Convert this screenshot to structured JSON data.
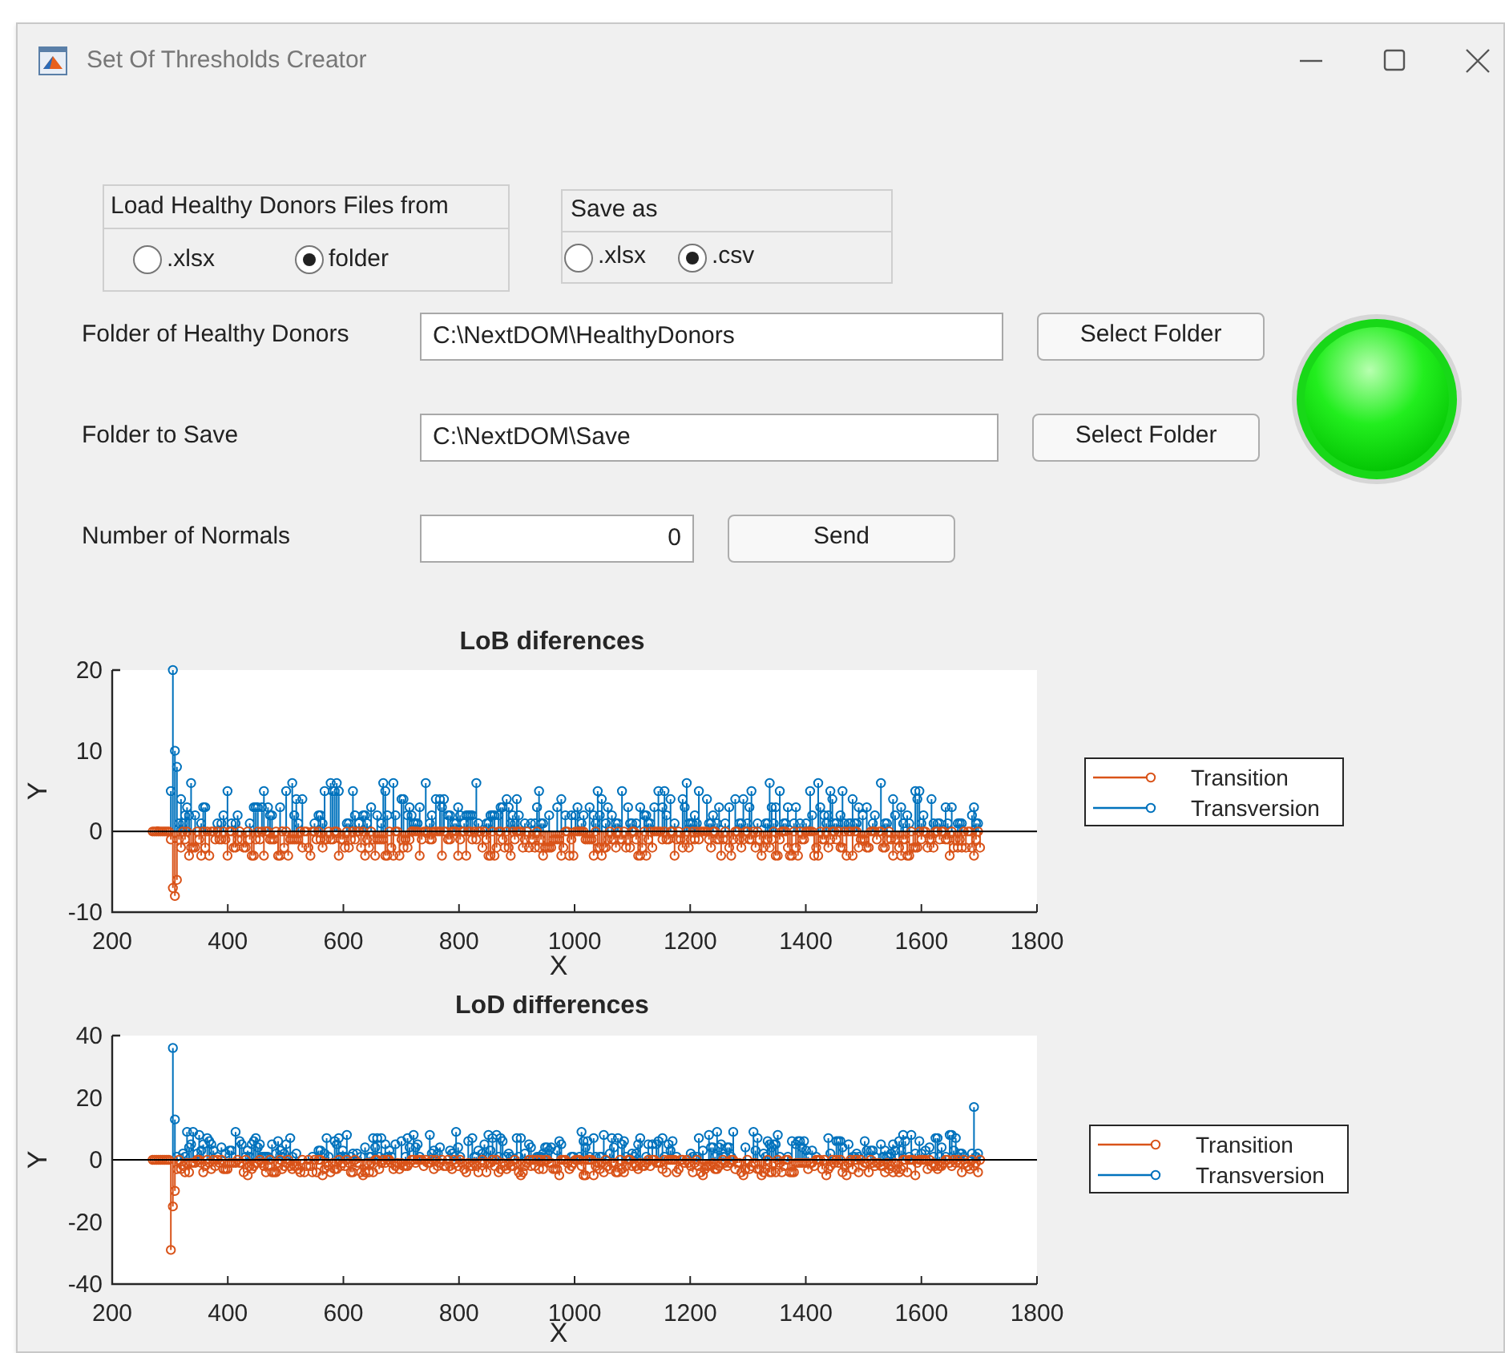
{
  "window": {
    "title": "Set Of Thresholds Creator"
  },
  "load_group": {
    "title": "Load Healthy Donors Files from",
    "options": [
      {
        "label": ".xlsx",
        "selected": false
      },
      {
        "label": "folder",
        "selected": true
      }
    ]
  },
  "save_group": {
    "title": "Save as",
    "options": [
      {
        "label": ".xlsx",
        "selected": false
      },
      {
        "label": ".csv",
        "selected": true
      }
    ]
  },
  "rows": [
    {
      "kind": "path",
      "label": "Folder of Healthy Donors",
      "value": "C:\\NextDOM\\HealthyDonors",
      "button": "Select Folder"
    },
    {
      "kind": "path",
      "label": "Folder to Save",
      "value": "C:\\NextDOM\\Save",
      "button": "Select Folder"
    },
    {
      "kind": "number",
      "label": "Number of Normals",
      "value": "0",
      "button": "Send"
    }
  ],
  "lamp": {
    "on": true
  },
  "plots": [
    {
      "title": "LoB diferences",
      "xlabel": "X",
      "ylabel": "Y",
      "xticks": [
        "200",
        "400",
        "600",
        "800",
        "1000",
        "1200",
        "1400",
        "1600",
        "1800"
      ],
      "yticks": [
        "20",
        "10",
        "0",
        "-10"
      ],
      "legend": [
        {
          "name": "Transition",
          "color": "#d95319"
        },
        {
          "name": "Transversion",
          "color": "#0072bd"
        }
      ]
    },
    {
      "title": "LoD differences",
      "xlabel": "X",
      "ylabel": "Y",
      "xticks": [
        "200",
        "400",
        "600",
        "800",
        "1000",
        "1200",
        "1400",
        "1600",
        "1800"
      ],
      "yticks": [
        "40",
        "20",
        "0",
        "-20",
        "-40"
      ],
      "legend": [
        {
          "name": "Transition",
          "color": "#d95319"
        },
        {
          "name": "Transversion",
          "color": "#0072bd"
        }
      ]
    }
  ]
}
